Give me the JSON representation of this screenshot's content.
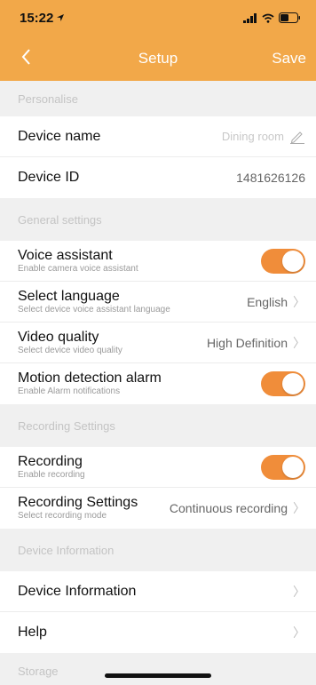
{
  "status_bar": {
    "time": "15:22"
  },
  "nav": {
    "title": "Setup",
    "save_label": "Save"
  },
  "sections": {
    "personalise": "Personalise",
    "general": "General settings",
    "recording": "Recording Settings",
    "device_info": "Device Information",
    "storage": "Storage"
  },
  "device_name": {
    "label": "Device name",
    "value": "Dining room"
  },
  "device_id": {
    "label": "Device ID",
    "value": "1481626126"
  },
  "voice_assistant": {
    "label": "Voice assistant",
    "sub": "Enable camera voice assistant",
    "enabled": true
  },
  "language": {
    "label": "Select language",
    "sub": "Select device voice assistant language",
    "value": "English"
  },
  "video_quality": {
    "label": "Video quality",
    "sub": "Select device video quality",
    "value": "High Definition"
  },
  "motion_alarm": {
    "label": "Motion detection alarm",
    "sub": "Enable Alarm notifications",
    "enabled": true
  },
  "recording": {
    "label": "Recording",
    "sub": "Enable recording",
    "enabled": true
  },
  "recording_settings": {
    "label": "Recording Settings",
    "sub": "Select recording mode",
    "value": "Continuous recording"
  },
  "device_information": {
    "label": "Device Information"
  },
  "help": {
    "label": "Help"
  },
  "colors": {
    "accent": "#f2a849",
    "toggle_on": "#f08d3a"
  }
}
